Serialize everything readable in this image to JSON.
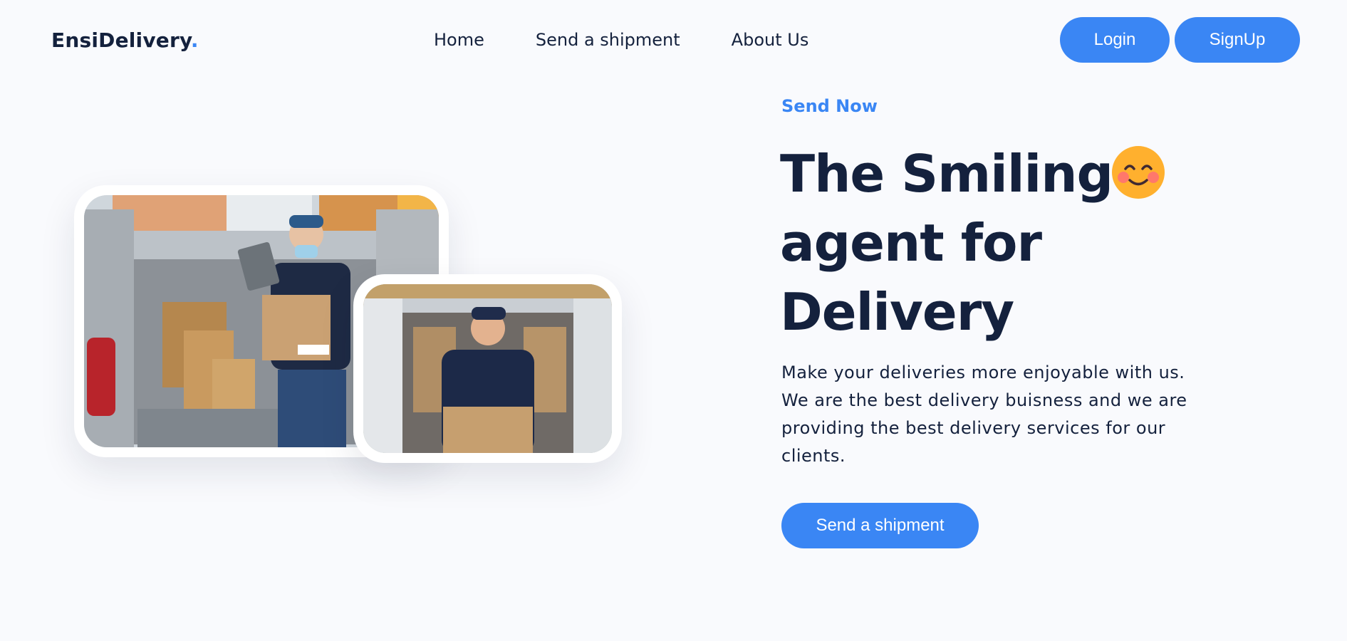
{
  "header": {
    "logo_text": "EnsiDelivery",
    "logo_dot": ".",
    "nav": {
      "home": "Home",
      "send_shipment": "Send a shipment",
      "about": "About Us"
    },
    "login_label": "Login",
    "signup_label": "SignUp"
  },
  "hero": {
    "eyebrow": "Send Now",
    "headline_line1": "The Smiling",
    "headline_line2": "agent for",
    "headline_line3": "Delivery",
    "emoji": "smiling-face-icon",
    "description": "Make your deliveries more enjoyable with us. We are the best delivery buisness and we are providing the best delivery services for our clients.",
    "cta_label": "Send a shipment"
  },
  "colors": {
    "accent": "#3a86f4",
    "text": "#14213d",
    "background": "#f9fafd"
  }
}
